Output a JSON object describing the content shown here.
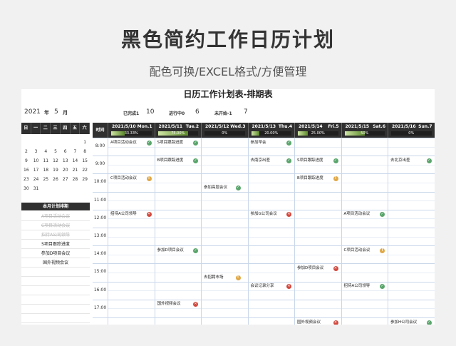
{
  "hero": {
    "title": "黑色简约工作日历计划",
    "subtitle": "配色可换/EXCEL格式/方便管理"
  },
  "sheet_title": "日历工作计划表-排期表",
  "header": {
    "year": "2021",
    "year_unit": "年",
    "month": "5",
    "month_unit": "月",
    "stats": [
      {
        "label": "已完成1",
        "value": "10"
      },
      {
        "label": "进行中0",
        "value": "6"
      },
      {
        "label": "未开始-1",
        "value": "7"
      }
    ]
  },
  "calendar": {
    "weekdays": [
      "日",
      "一",
      "二",
      "三",
      "四",
      "五",
      "六"
    ],
    "cells": [
      "",
      "",
      "",
      "",
      "",
      "",
      "1",
      "2",
      "3",
      "4",
      "5",
      "6",
      "7",
      "8",
      "9",
      "10",
      "11",
      "12",
      "13",
      "14",
      "15",
      "16",
      "17",
      "18",
      "19",
      "20",
      "21",
      "22",
      "23",
      "24",
      "25",
      "26",
      "27",
      "28",
      "29",
      "30",
      "31",
      "",
      "",
      "",
      "",
      ""
    ]
  },
  "monthly_plan": {
    "title": "本月计划排期",
    "items": [
      {
        "text": "A项目活动会议",
        "done": true
      },
      {
        "text": "C项目活动会议",
        "done": true
      },
      {
        "text": "招待A公司领导",
        "done": true
      },
      {
        "text": "S项目跟踪进度",
        "done": false
      },
      {
        "text": "参加D项目会议",
        "done": false
      },
      {
        "text": "国外视频会议",
        "done": false
      }
    ]
  },
  "schedule": {
    "time_header": "时间",
    "days": [
      {
        "date": "2021/5/10",
        "weekday": "Mon.1",
        "progress": 0.3333,
        "progress_text": "33.33%"
      },
      {
        "date": "2021/5/11",
        "weekday": "Tue.2",
        "progress": 0.75,
        "progress_text": "75.00%"
      },
      {
        "date": "2021/5/12",
        "weekday": "Wed.3",
        "progress": 0.0,
        "progress_text": "0%"
      },
      {
        "date": "2021/5/13",
        "weekday": "Thu.4",
        "progress": 0.2,
        "progress_text": "20.00%"
      },
      {
        "date": "2021/5/14",
        "weekday": "Fri.5",
        "progress": 0.25,
        "progress_text": "25.00%"
      },
      {
        "date": "2021/5/15",
        "weekday": "Sat.6",
        "progress": 0.5,
        "progress_text": "50%"
      },
      {
        "date": "2021/5/16",
        "weekday": "Sun.7",
        "progress": 0.0,
        "progress_text": "0%"
      }
    ],
    "times": [
      "8:00",
      "9:00",
      "10:00",
      "11:00",
      "12:00",
      "13:00",
      "14:00",
      "15:00",
      "16:00",
      "17:00"
    ],
    "events": [
      {
        "day": 0,
        "slot": 0,
        "name": "A项目活动会议",
        "status": "ok"
      },
      {
        "day": 1,
        "slot": 0,
        "name": "S项目跟踪进度",
        "status": "ok"
      },
      {
        "day": 3,
        "slot": 0,
        "name": "参加早会",
        "status": "ok"
      },
      {
        "day": 1,
        "slot": 2,
        "name": "B项目跟踪进度",
        "status": "ok"
      },
      {
        "day": 3,
        "slot": 2,
        "name": "去南京出差",
        "status": "ok"
      },
      {
        "day": 4,
        "slot": 2,
        "name": "S项目跟踪进度",
        "status": "ok"
      },
      {
        "day": 6,
        "slot": 2,
        "name": "去北京出差",
        "status": "ok"
      },
      {
        "day": 0,
        "slot": 4,
        "name": "C项目活动会议",
        "status": "warn"
      },
      {
        "day": 4,
        "slot": 4,
        "name": "B项目跟踪进度",
        "status": "warn"
      },
      {
        "day": 2,
        "slot": 5,
        "name": "参加高层会议",
        "status": "ok"
      },
      {
        "day": 0,
        "slot": 8,
        "name": "招待A公司领导",
        "status": "x"
      },
      {
        "day": 3,
        "slot": 8,
        "name": "参加G公司会议",
        "status": "x"
      },
      {
        "day": 5,
        "slot": 8,
        "name": "A项目活动会议",
        "status": "ok"
      },
      {
        "day": 1,
        "slot": 12,
        "name": "参加D项目会议",
        "status": "ok"
      },
      {
        "day": 5,
        "slot": 12,
        "name": "C项目活动会议",
        "status": "warn"
      },
      {
        "day": 4,
        "slot": 14,
        "name": "参加D项目会议",
        "status": "x"
      },
      {
        "day": 2,
        "slot": 15,
        "name": "去招聘市场",
        "status": "warn"
      },
      {
        "day": 3,
        "slot": 16,
        "name": "会议记录分享",
        "status": "x"
      },
      {
        "day": 5,
        "slot": 16,
        "name": "招待A公司领导",
        "status": "ok"
      },
      {
        "day": 1,
        "slot": 18,
        "name": "国外视频会议",
        "status": "x"
      },
      {
        "day": 4,
        "slot": 20,
        "name": "国外视频会议",
        "status": "x"
      },
      {
        "day": 6,
        "slot": 20,
        "name": "参加H公司会议",
        "status": "ok"
      }
    ]
  }
}
